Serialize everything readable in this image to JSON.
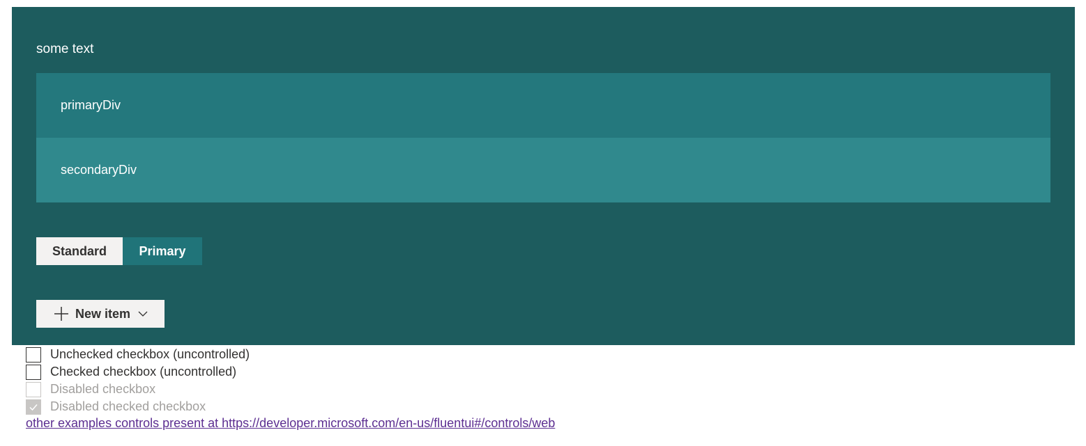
{
  "panel": {
    "heading": "some text",
    "primary_div": "primaryDiv",
    "secondary_div": "secondaryDiv"
  },
  "buttons": {
    "standard_label": "Standard",
    "primary_label": "Primary"
  },
  "new_item": {
    "label": "New item",
    "icon": "plus-icon",
    "chevron_icon": "chevron-down-icon"
  },
  "checkboxes": [
    {
      "label": "Unchecked checkbox (uncontrolled)",
      "checked": false,
      "disabled": false
    },
    {
      "label": "Checked checkbox (uncontrolled)",
      "checked": false,
      "disabled": false
    },
    {
      "label": "Disabled checkbox",
      "checked": false,
      "disabled": true
    },
    {
      "label": "Disabled checked checkbox",
      "checked": true,
      "disabled": true
    }
  ],
  "footer_link": "other examples controls present at https://developer.microsoft.com/en-us/fluentui#/controls/web",
  "colors": {
    "panel_bg": "#1d5c5e",
    "primary_div_bg": "#24787d",
    "secondary_div_bg": "#30898d",
    "primary_button_bg": "#207479",
    "link": "#5c2e91"
  }
}
